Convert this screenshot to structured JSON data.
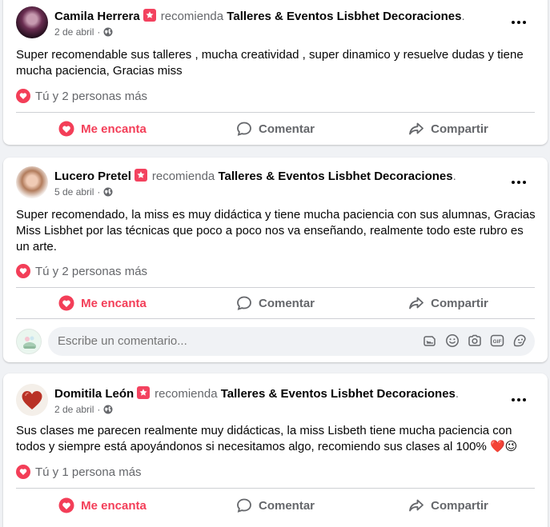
{
  "labels": {
    "recommends": "recomienda",
    "love": "Me encanta",
    "comment": "Comentar",
    "share": "Compartir"
  },
  "posts": [
    {
      "author": "Camila Herrera",
      "page": "Talleres & Eventos Lisbhet Decoraciones",
      "date": "2 de abril",
      "text": "Super recomendable sus talleres , mucha creatividad , super dinamico y resuelve dudas y tiene mucha paciencia, Gracias miss",
      "reactions": "Tú y 2 personas más"
    },
    {
      "author": "Lucero Pretel",
      "page": "Talleres & Eventos Lisbhet Decoraciones",
      "date": "5 de abril",
      "text": "Super recomendado, la miss es muy didáctica y tiene mucha paciencia con sus alumnas, Gracias Miss Lisbhet por las técnicas que poco a poco nos va enseñando, realmente todo este rubro es un arte.",
      "reactions": "Tú y 2 personas más"
    },
    {
      "author": "Domitila León",
      "page": "Talleres & Eventos Lisbhet Decoraciones",
      "date": "2 de abril",
      "text": "Sus clases me parecen realmente muy didácticas, la miss Lisbeth tiene mucha paciencia con todos y siempre está apoyándonos si necesitamos algo, recomiendo sus  clases al 100% ❤️😉",
      "reactions": "Tú y 1 persona más"
    }
  ],
  "comment_box": {
    "placeholder": "Escribe un comentario..."
  },
  "colors": {
    "love": "#f33e58",
    "secondary_text": "#65676b",
    "background": "#f0f2f5"
  },
  "icons": [
    "recommend-badge-icon",
    "globe-icon",
    "more-options-icon",
    "heart-icon",
    "comment-icon",
    "share-icon",
    "sticker-icon",
    "emoji-icon",
    "camera-icon",
    "gif-icon",
    "avatar-sticker-icon"
  ]
}
